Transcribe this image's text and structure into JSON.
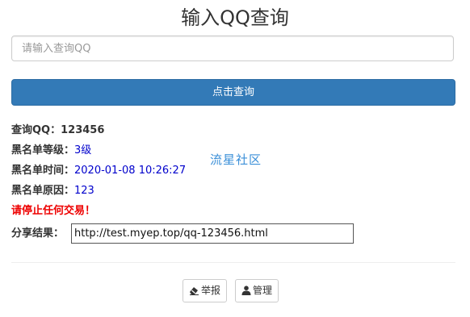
{
  "header": {
    "title": "输入QQ查询"
  },
  "search": {
    "placeholder": "请输入查询QQ",
    "button_label": "点击查询"
  },
  "result": {
    "qq_label": "查询QQ：",
    "qq_value": "123456",
    "level_label": "黑名单等级：",
    "level_value": "3级",
    "time_label": "黑名单时间：",
    "time_value": "2020-01-08 10:26:27",
    "reason_label": "黑名单原因：",
    "reason_value": "123",
    "warning": "请停止任何交易！",
    "share_label": "分享结果：",
    "share_value": "http://test.myep.top/qq-123456.html"
  },
  "watermark": "流星社区",
  "footer": {
    "report_label": "举报",
    "manage_label": "管理"
  },
  "colors": {
    "primary": "#337ab7",
    "link_value": "#0000cc",
    "warning": "#ee0000",
    "watermark": "#3a8fd8"
  },
  "icons": {
    "report": "eraser-icon",
    "manage": "user-icon"
  }
}
